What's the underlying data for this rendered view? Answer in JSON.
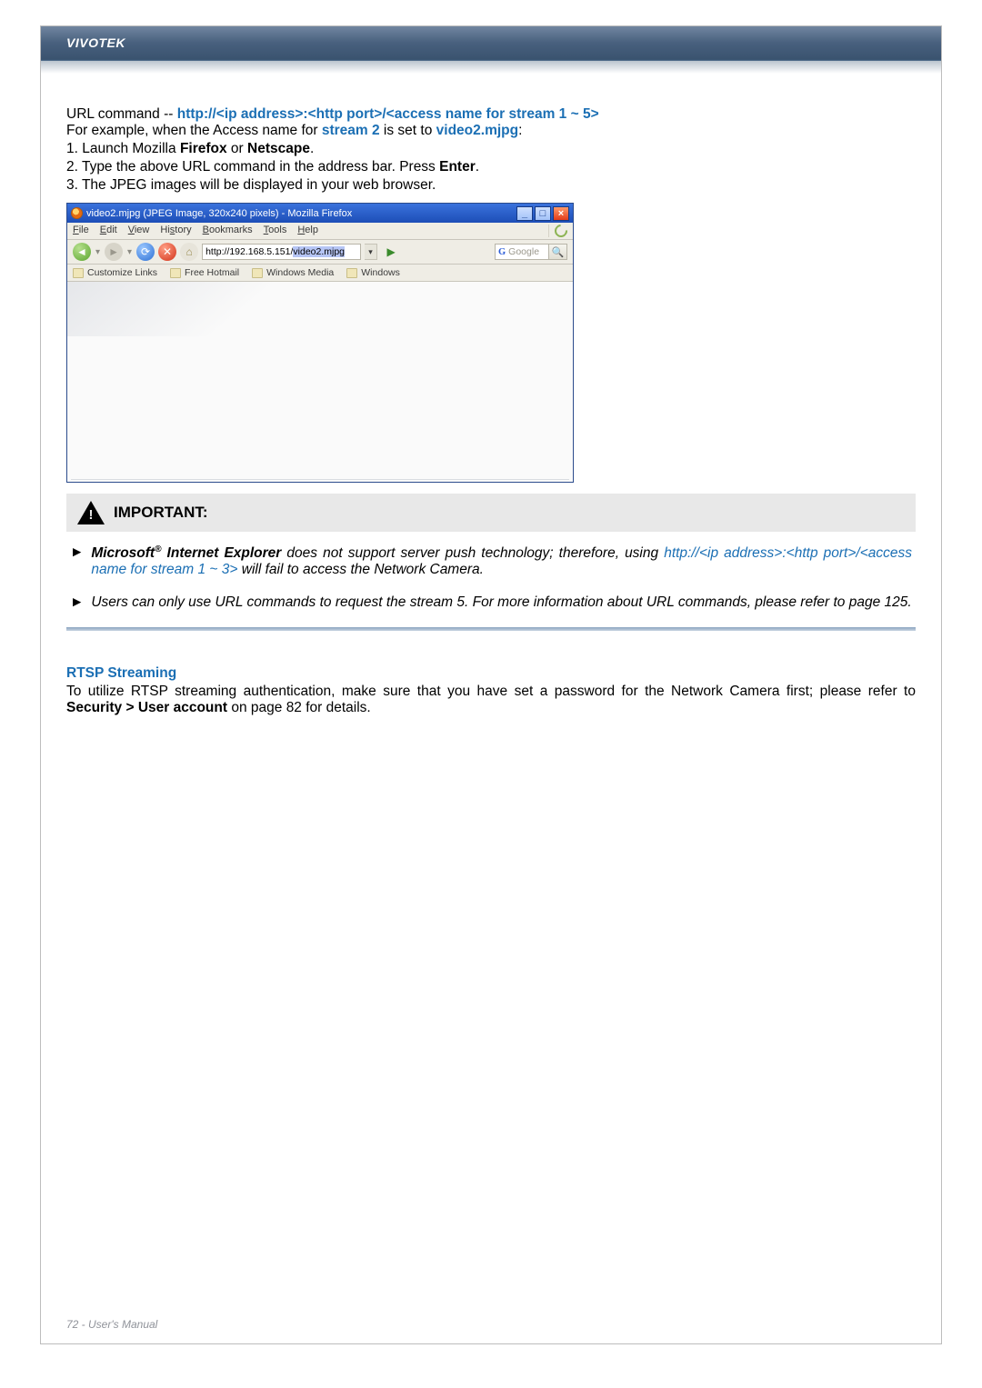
{
  "header": {
    "brand": "VIVOTEK"
  },
  "intro": {
    "prefix": "URL command -- ",
    "url_pattern": "http://<ip address>:<http port>/<access name for stream 1 ~ 5>",
    "line2_pre": "For example, when the Access name for ",
    "line2_s": "stream 2",
    "line2_mid": " is set to ",
    "line2_file": "video2.mjpg",
    "line2_post": ":",
    "step1_a": "1. Launch Mozilla ",
    "step1_b": "Firefox",
    "step1_c": " or ",
    "step1_d": "Netscape",
    "step1_e": ".",
    "step2_a": "2. Type the above URL command in the address bar. Press ",
    "step2_b": "Enter",
    "step2_c": ".",
    "step3": "3. The JPEG images will be displayed in your web browser."
  },
  "ff": {
    "title": "video2.mjpg (JPEG Image, 320x240 pixels) - Mozilla Firefox",
    "menu": [
      "File",
      "Edit",
      "View",
      "History",
      "Bookmarks",
      "Tools",
      "Help"
    ],
    "url_left": "http://192.168.5.151/",
    "url_sel": "video2.mjpg",
    "search_placeholder": "Google",
    "bookmarks": [
      "Customize Links",
      "Free Hotmail",
      "Windows Media",
      "Windows"
    ]
  },
  "important": {
    "label": "IMPORTANT:"
  },
  "notes": {
    "n1_a": "Microsoft",
    "n1_reg": "®",
    "n1_b": " Internet Explorer",
    "n1_c": " does not support server push technology; therefore, using ",
    "n1_d": "http://<ip address>:<http port>/<access name for stream 1 ~ 3>",
    "n1_e": " will fail to access the Network Camera.",
    "n2": "Users can only use URL commands to request the stream 5. For more information about URL commands, please refer to page 125."
  },
  "rtsp": {
    "title": "RTSP Streaming",
    "t1": "To utilize RTSP streaming authentication, make sure that you have set a password for the Network Camera first; please refer to ",
    "t2": "Security > User account",
    "t3": " on page 82 for details."
  },
  "footer": {
    "text": "72 - User's Manual"
  }
}
